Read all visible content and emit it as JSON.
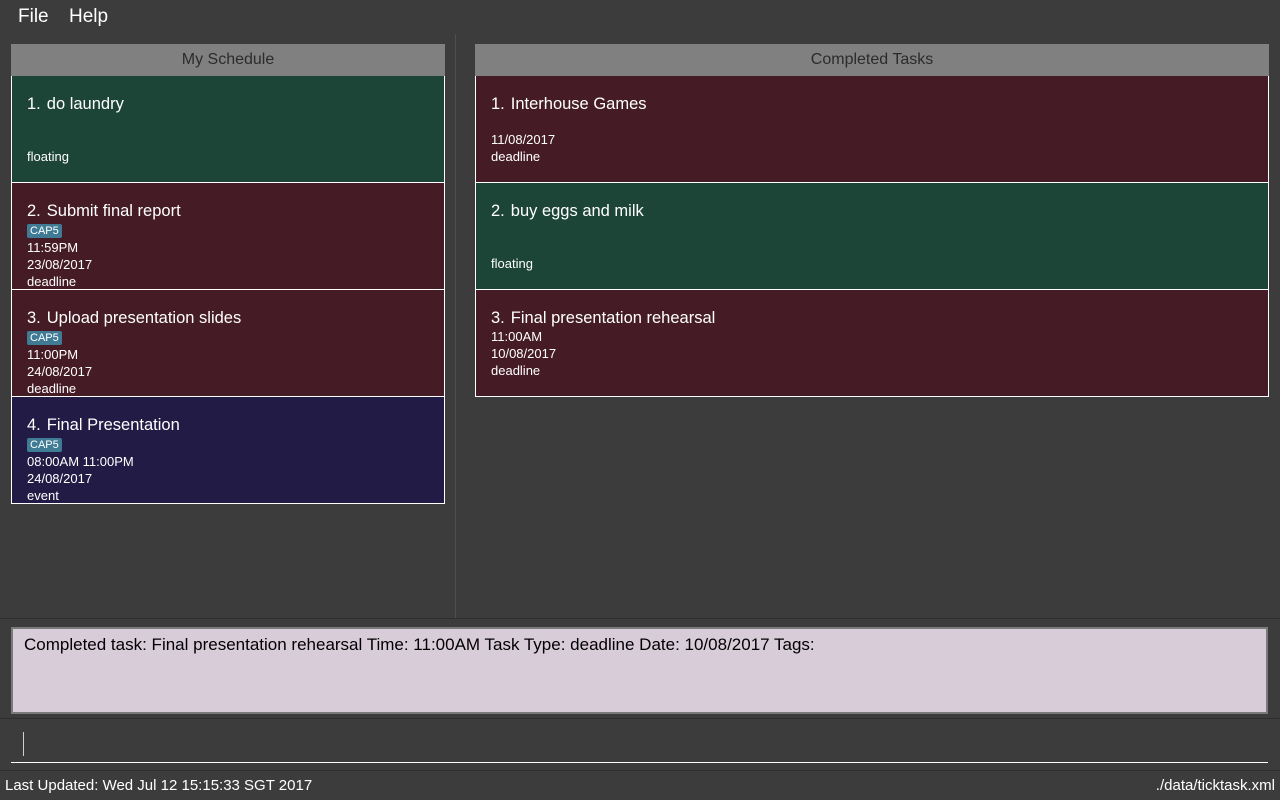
{
  "menu": {
    "file": "File",
    "help": "Help"
  },
  "schedule": {
    "header": "My Schedule",
    "tasks": [
      {
        "index": "1.",
        "name": "do laundry",
        "tag": "",
        "time": "",
        "date": "",
        "type": "floating"
      },
      {
        "index": "2.",
        "name": "Submit final report",
        "tag": "CAP5",
        "time": "11:59PM",
        "date": "23/08/2017",
        "type": "deadline"
      },
      {
        "index": "3.",
        "name": "Upload presentation slides",
        "tag": "CAP5",
        "time": "11:00PM",
        "date": "24/08/2017",
        "type": "deadline"
      },
      {
        "index": "4.",
        "name": "Final Presentation",
        "tag": "CAP5",
        "time": "08:00AM 11:00PM",
        "date": "24/08/2017",
        "type": "event"
      }
    ]
  },
  "completed": {
    "header": "Completed Tasks",
    "tasks": [
      {
        "index": "1.",
        "name": "Interhouse Games",
        "time": "",
        "date": "11/08/2017",
        "type": "deadline"
      },
      {
        "index": "2.",
        "name": "buy eggs and milk",
        "time": "",
        "date": "",
        "type": "floating"
      },
      {
        "index": "3.",
        "name": "Final presentation rehearsal",
        "time": "11:00AM",
        "date": "10/08/2017",
        "type": "deadline"
      }
    ]
  },
  "result": {
    "text": "Completed task: Final presentation rehearsal Time: 11:00AM  Task Type: deadline Date: 10/08/2017  Tags:"
  },
  "command": {
    "value": "",
    "placeholder": ""
  },
  "status": {
    "last_updated": "Last Updated: Wed Jul 12 15:15:33 SGT 2017",
    "file_path": "./data/ticktask.xml"
  },
  "colors": {
    "floating": "#1d4537",
    "deadline": "#451c26",
    "event": "#211b45",
    "tag": "#3f7b94",
    "result_bg": "#d9ccd9"
  }
}
